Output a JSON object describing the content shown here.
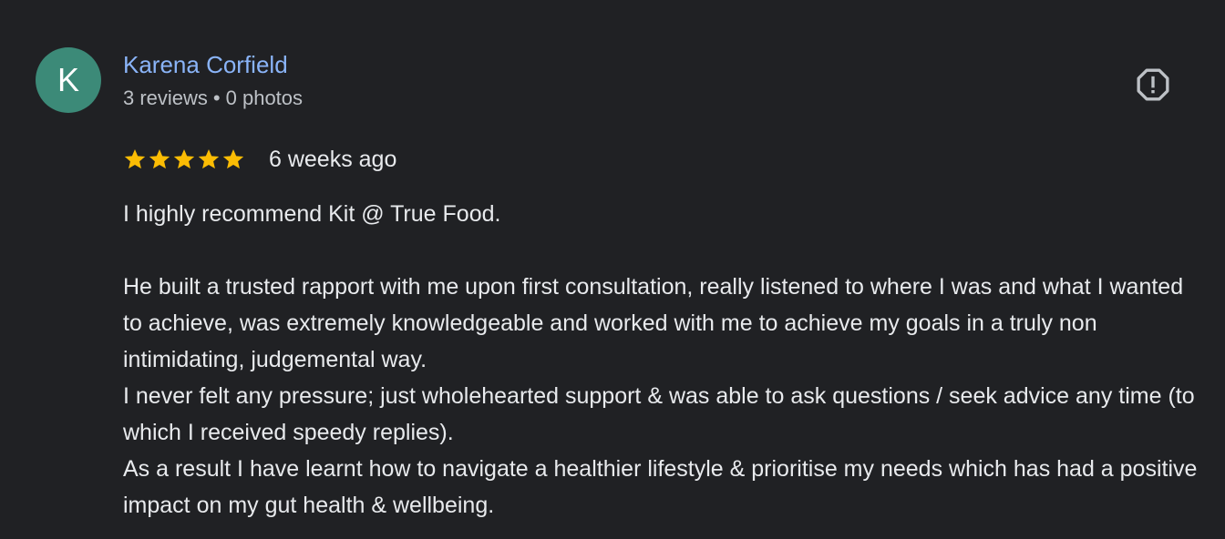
{
  "reviewer": {
    "avatar_initial": "K",
    "name": "Karena Corfield",
    "reviews_count": "3 reviews",
    "separator": "•",
    "photos_count": "0 photos"
  },
  "rating": {
    "stars": 5,
    "max_stars": 5,
    "time_ago": "6 weeks ago"
  },
  "review": {
    "paragraphs": [
      "I highly recommend Kit @ True Food.",
      "",
      "He built a trusted rapport with me upon first consultation, really listened to where I was and what I wanted to achieve, was extremely knowledgeable and worked with me to achieve my goals in a truly non intimidating, judgemental way.",
      "I never felt any pressure; just wholehearted support & was able to ask questions / seek advice any time (to which I received speedy replies).",
      "As a result I have learnt how to navigate a healthier lifestyle & prioritise my needs which has had a positive impact on my gut health & wellbeing."
    ]
  },
  "icons": {
    "report": "report-flag-icon",
    "star": "star-icon"
  },
  "colors": {
    "background": "#202124",
    "avatar": "#3c8a78",
    "name_link": "#8ab4f8",
    "star": "#fbbc04",
    "icon": "#bdc1c6"
  }
}
